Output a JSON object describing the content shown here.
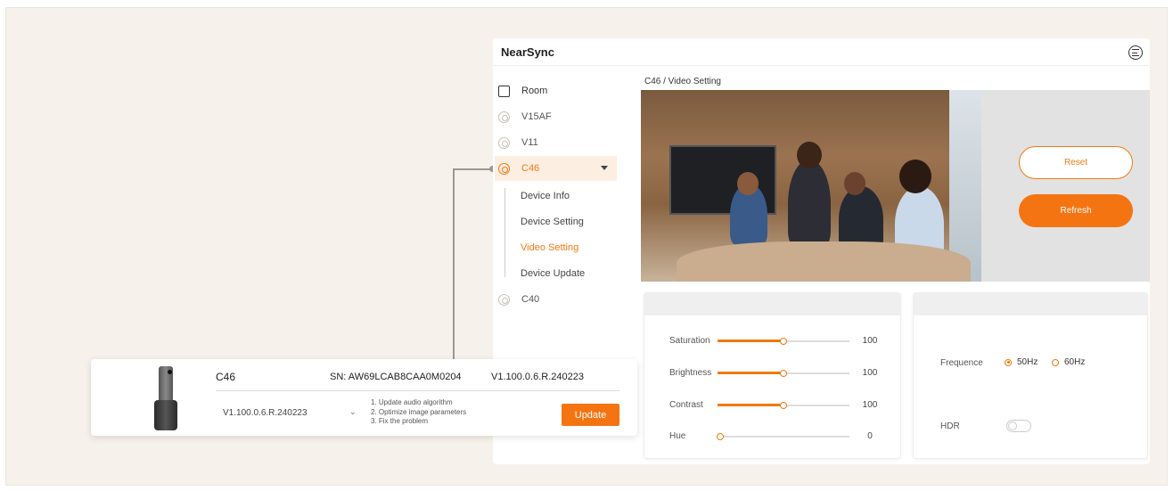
{
  "app": {
    "title": "NearSync"
  },
  "sidebar": {
    "items": [
      {
        "label": "Room",
        "icon": "home-icon"
      },
      {
        "label": "V15AF",
        "icon": "camera-icon"
      },
      {
        "label": "V11",
        "icon": "camera-icon"
      },
      {
        "label": "C46",
        "icon": "camera-icon"
      },
      {
        "label": "C40",
        "icon": "camera-icon"
      }
    ],
    "sub_items": [
      {
        "label": "Device Info"
      },
      {
        "label": "Device Setting"
      },
      {
        "label": "Video Setting"
      },
      {
        "label": "Device Update"
      }
    ]
  },
  "main": {
    "breadcrumb": "C46 / Video Setting",
    "reset_label": "Reset",
    "refresh_label": "Refresh",
    "sliders": [
      {
        "label": "Saturation",
        "value": "100",
        "level": 0.5
      },
      {
        "label": "Brightness",
        "value": "100",
        "level": 0.5
      },
      {
        "label": "Contrast",
        "value": "100",
        "level": 0.5
      },
      {
        "label": "Hue",
        "value": "0",
        "level": 0
      }
    ],
    "frequence": {
      "label": "Frequence",
      "options": [
        "50Hz",
        "60Hz"
      ],
      "selected": "50Hz"
    },
    "hdr": {
      "label": "HDR",
      "on": false
    }
  },
  "popup": {
    "name": "C46",
    "sn": "SN: AW69LCAB8CAA0M0204",
    "version": "V1.100.0.6.R.240223",
    "selected_version": "V1.100.0.6.R.240223",
    "notes": [
      "1. Update audio algorithm",
      "2. Optimize image parameters",
      "3. Fix the problem"
    ],
    "update_label": "Update"
  },
  "colors": {
    "accent": "#f57412",
    "active_bg": "#fdeee2"
  }
}
